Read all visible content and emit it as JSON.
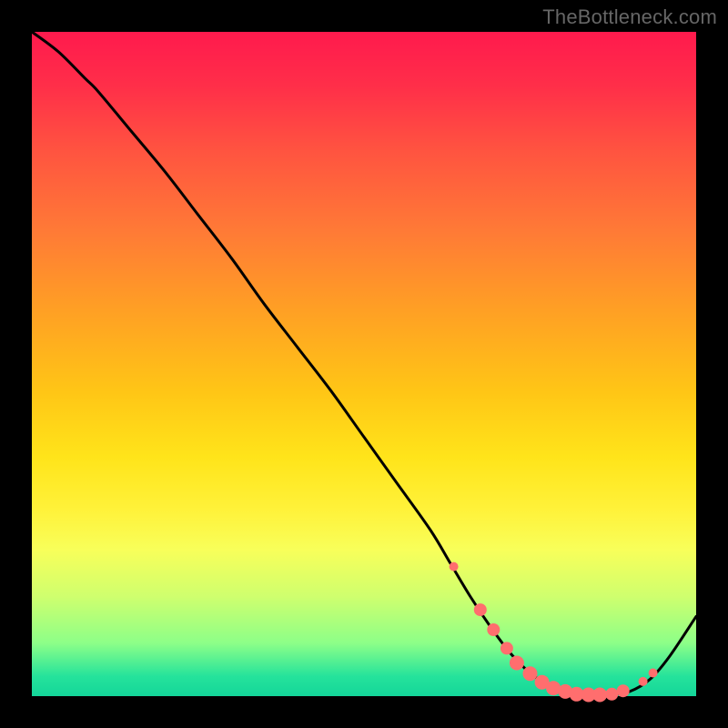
{
  "watermark": "TheBottleneck.com",
  "colors": {
    "background": "#000000",
    "curve": "#000000",
    "markers_fill": "#ff6e6e",
    "markers_stroke": "#c84a4a"
  },
  "chart_data": {
    "type": "line",
    "title": "",
    "xlabel": "",
    "ylabel": "",
    "xlim": [
      0,
      100
    ],
    "ylim": [
      0,
      100
    ],
    "series": [
      {
        "name": "curve",
        "x": [
          0,
          4,
          8,
          10,
          15,
          20,
          25,
          30,
          35,
          40,
          45,
          50,
          55,
          60,
          63,
          66,
          69,
          72,
          75,
          78,
          81,
          84,
          87,
          90,
          93,
          96,
          100
        ],
        "y": [
          100,
          97,
          93,
          91,
          85,
          79,
          72.5,
          66,
          59,
          52.5,
          46,
          39,
          32,
          25,
          20,
          15,
          10.5,
          6.5,
          3.5,
          1.5,
          0.5,
          0.2,
          0.2,
          0.7,
          2.5,
          6,
          12
        ]
      }
    ],
    "markers": {
      "name": "highlight",
      "points": [
        {
          "x": 63.5,
          "y": 19.5,
          "r": 5
        },
        {
          "x": 67.5,
          "y": 13.0,
          "r": 7
        },
        {
          "x": 69.5,
          "y": 10.0,
          "r": 7
        },
        {
          "x": 71.5,
          "y": 7.2,
          "r": 7
        },
        {
          "x": 73.0,
          "y": 5.0,
          "r": 8
        },
        {
          "x": 75.0,
          "y": 3.4,
          "r": 8
        },
        {
          "x": 76.8,
          "y": 2.1,
          "r": 8
        },
        {
          "x": 78.5,
          "y": 1.2,
          "r": 8
        },
        {
          "x": 80.3,
          "y": 0.7,
          "r": 8
        },
        {
          "x": 82.0,
          "y": 0.3,
          "r": 8
        },
        {
          "x": 83.8,
          "y": 0.2,
          "r": 8
        },
        {
          "x": 85.5,
          "y": 0.2,
          "r": 8
        },
        {
          "x": 87.3,
          "y": 0.3,
          "r": 7
        },
        {
          "x": 89.0,
          "y": 0.8,
          "r": 7
        },
        {
          "x": 92.0,
          "y": 2.2,
          "r": 5
        },
        {
          "x": 93.5,
          "y": 3.5,
          "r": 5
        }
      ]
    }
  }
}
